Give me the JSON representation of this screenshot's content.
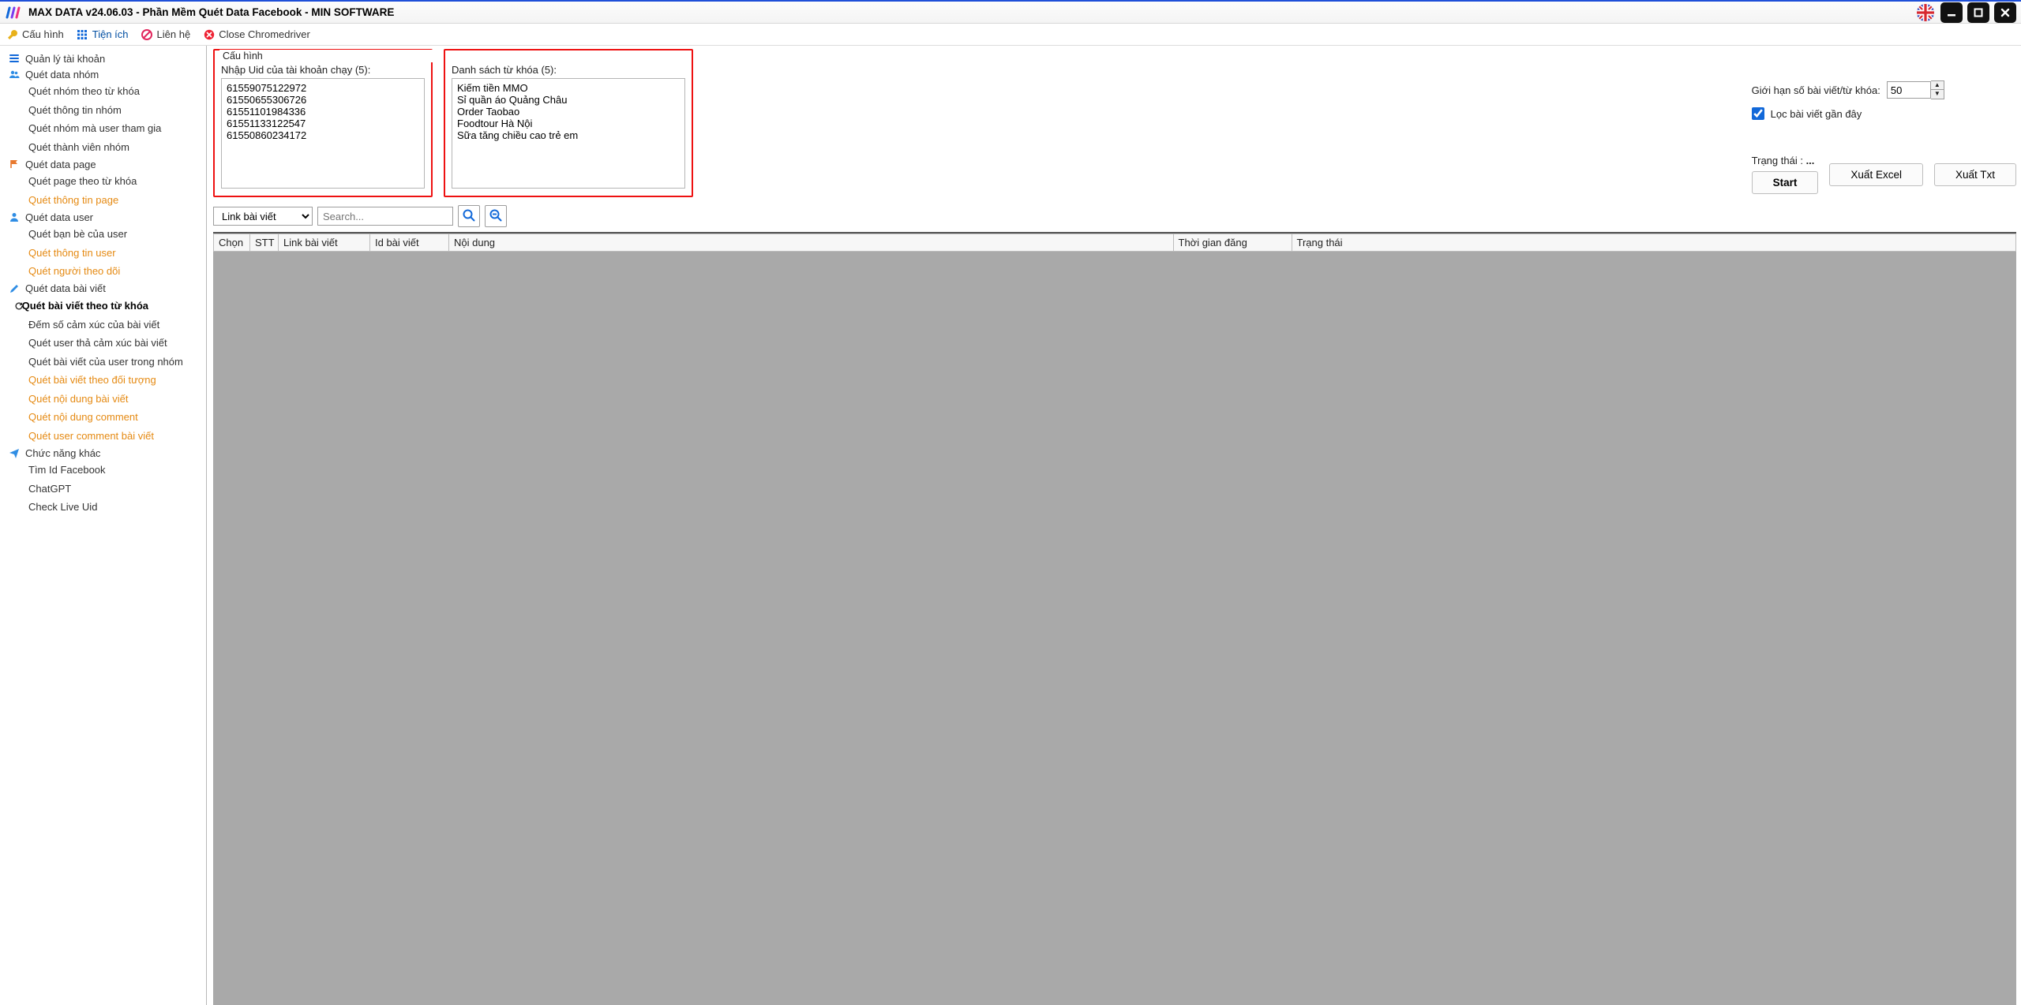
{
  "title": "MAX DATA v24.06.03 - Phần Mềm Quét Data Facebook - MIN SOFTWARE",
  "toolbar": {
    "config": "Cấu hình",
    "utilities": "Tiện ích",
    "contact": "Liên hệ",
    "close_driver": "Close Chromedriver"
  },
  "sidebar": {
    "g_accounts": "Quản lý tài khoản",
    "g_groups": "Quét data nhóm",
    "groups": {
      "by_keyword": "Quét nhóm theo từ khóa",
      "info": "Quét thông tin nhóm",
      "by_user": "Quét nhóm mà user tham gia",
      "members": "Quét thành viên nhóm"
    },
    "g_pages": "Quét data page",
    "pages": {
      "by_keyword": "Quét page theo từ khóa",
      "info": "Quét thông tin page"
    },
    "g_users": "Quét data user",
    "users": {
      "friends": "Quét bạn bè của user",
      "info": "Quét thông tin user",
      "followers": "Quét người theo dõi"
    },
    "g_posts": "Quét data bài viết",
    "posts": {
      "by_keyword": "Quét bài viết theo từ khóa",
      "reactions_count": "Đếm số cảm xúc của bài viết",
      "reactors": "Quét user thả cảm xúc bài viết",
      "user_in_group": "Quét bài viết của user trong nhóm",
      "by_audience": "Quét bài viết theo đối tượng",
      "content": "Quét nội dung bài viết",
      "comments": "Quét nội dung comment",
      "commenters": "Quét user comment bài viết"
    },
    "g_other": "Chức năng khác",
    "other": {
      "find_id": "Tìm Id Facebook",
      "chatgpt": "ChatGPT",
      "check_live": "Check Live Uid"
    }
  },
  "config": {
    "legend1": "Cấu hình",
    "uid_label": "Nhập Uid của tài khoản chạy (5):",
    "uid_text": "61559075122972\n61550655306726\n61551101984336\n61551133122547\n61550860234172",
    "kw_label": "Danh sách từ khóa (5):",
    "kw_text": "Kiếm tiền MMO\nSỉ quần áo Quảng Châu\nOrder Taobao\nFoodtour Hà Nội\nSữa tăng chiều cao trẻ em"
  },
  "opts": {
    "limit_label": "Giới hạn số bài viết/từ khóa:",
    "limit_value": "50",
    "recent_label": "Lọc bài viết gần đây"
  },
  "status": {
    "label": "Trạng thái :",
    "value": "...",
    "start": "Start",
    "export_excel": "Xuất Excel",
    "export_txt": "Xuất Txt"
  },
  "search": {
    "dropdown": "Link bài viết",
    "placeholder": "Search..."
  },
  "table": {
    "cols": [
      "Chọn",
      "STT",
      "Link bài viết",
      "Id bài viết",
      "Nội dung",
      "Thời gian đăng",
      "Trạng thái"
    ]
  }
}
